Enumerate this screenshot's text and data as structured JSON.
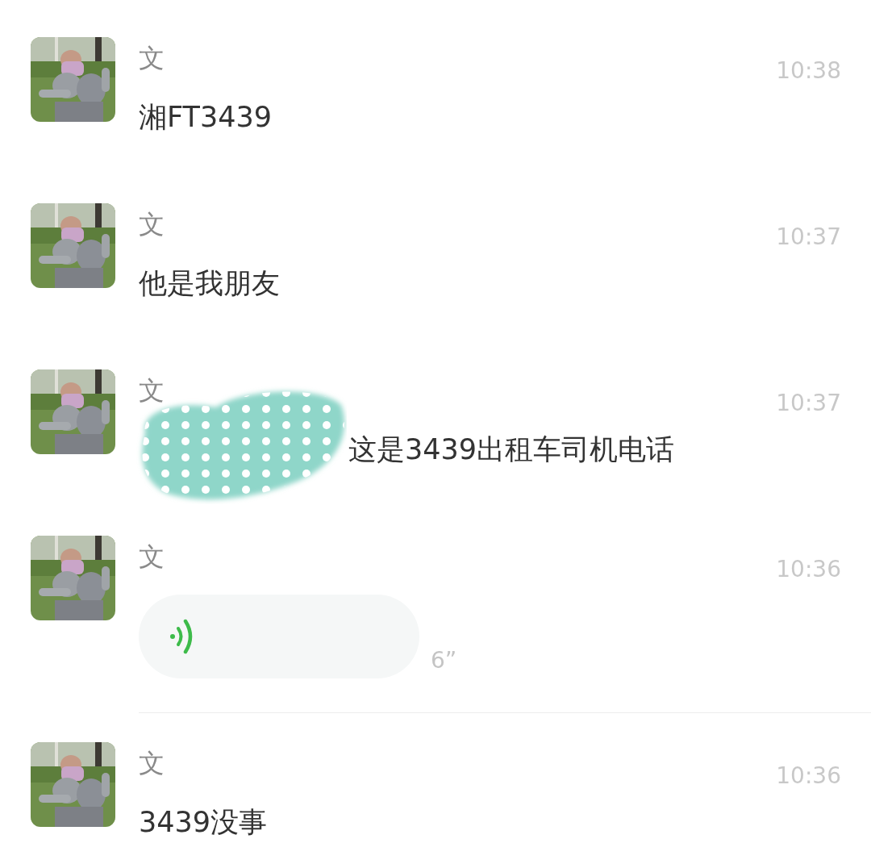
{
  "messages": [
    {
      "kind": "text",
      "sender": "文",
      "time": "10:38",
      "text": "湘FT3439"
    },
    {
      "kind": "text",
      "sender": "文",
      "time": "10:37",
      "text": "他是我朋友"
    },
    {
      "kind": "redacted",
      "sender": "文",
      "time": "10:37",
      "text": "这是3439出租车司机电话"
    },
    {
      "kind": "voice",
      "sender": "文",
      "time": "10:36",
      "duration": "6”"
    },
    {
      "kind": "text",
      "sender": "文",
      "time": "10:36",
      "text": "3439没事"
    }
  ]
}
